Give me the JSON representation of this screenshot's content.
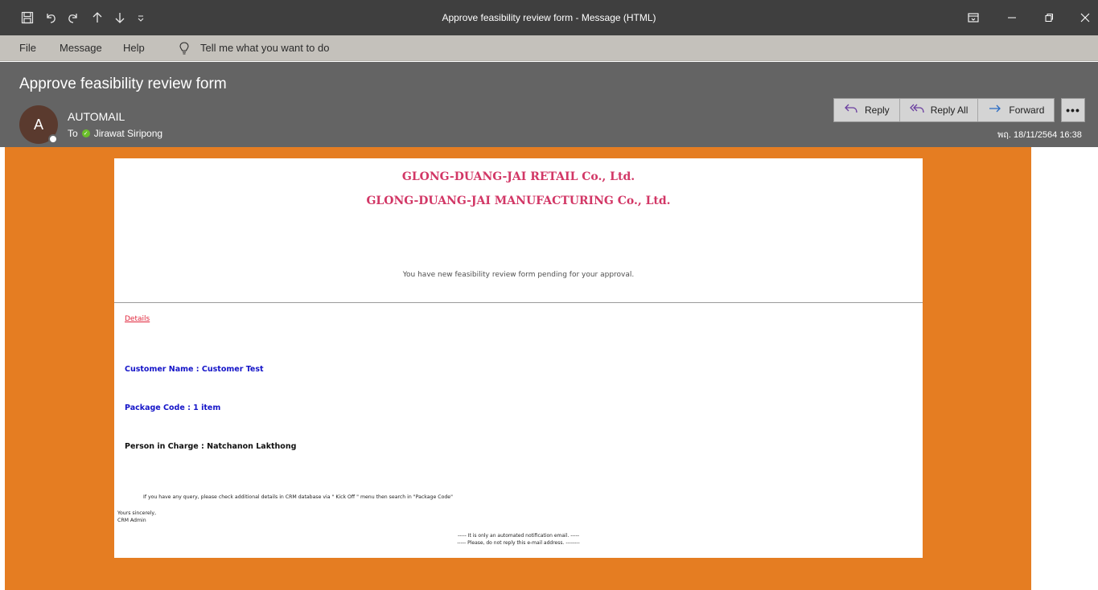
{
  "window": {
    "title": "Approve feasibility review form  -  Message (HTML)",
    "quick_access": [
      "save-icon",
      "undo-icon",
      "redo-icon",
      "up-arrow-icon",
      "down-arrow-icon",
      "customize-icon"
    ],
    "controls": [
      "ribbon-display-icon",
      "minimize-icon",
      "restore-icon",
      "close-icon"
    ]
  },
  "ribbon": {
    "file": "File",
    "message": "Message",
    "help": "Help",
    "tell_me": "Tell me what you want to do"
  },
  "header": {
    "subject": "Approve feasibility review form",
    "avatar_initial": "A",
    "sender": "AUTOMAIL",
    "to_label": "To",
    "recipient": "Jirawat Siripong",
    "reply": "Reply",
    "reply_all": "Reply All",
    "forward": "Forward",
    "more": "•••",
    "datetime": "พฤ. 18/11/2564 16:38"
  },
  "email": {
    "company1": "GLONG-DUANG-JAI RETAIL Co., Ltd.",
    "company2": "GLONG-DUANG-JAI MANUFACTURING Co., Ltd.",
    "notice": "You have new feasibility review form pending for your approval.",
    "details_link": "Details",
    "customer": "Customer Name : Customer Test",
    "package": "Package Code : 1 item",
    "person": "Person in Charge : Natchanon Lakthong",
    "query": "If you have any query, please check additional details in CRM database via \" Kick Off \" menu then search in \"Package Code\"",
    "sign1": "Yours sincerely,",
    "sign2": "CRM Admin",
    "footer1": "----- It is only an automated notification email. -----",
    "footer2": "----- Please, do not reply this e-mail address. --------"
  },
  "colors": {
    "titlebar": "#3f3f3f",
    "ribbon": "#c4c1bb",
    "header": "#646464",
    "body_bg": "#e57d22",
    "company_text": "#d23766",
    "field_blue": "#1414c8",
    "link_red": "#e0243a"
  }
}
